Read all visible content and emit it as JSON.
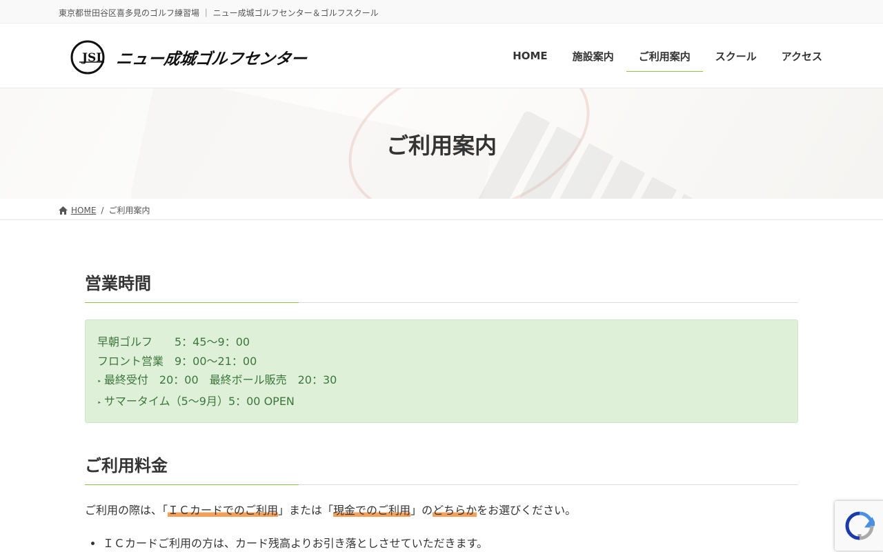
{
  "topbar": {
    "text": "東京都世田谷区喜多見のゴルフ練習場 ｜ ニュー成城ゴルフセンター＆ゴルフスクール"
  },
  "header": {
    "logo_text": "ニュー成城ゴルフセンター",
    "nav": [
      {
        "label": "HOME"
      },
      {
        "label": "施設案内"
      },
      {
        "label": "ご利用案内"
      },
      {
        "label": "スクール"
      },
      {
        "label": "アクセス"
      }
    ],
    "active_nav": "ご利用案内"
  },
  "hero": {
    "title": "ご利用案内"
  },
  "breadcrumb": {
    "home": "HOME",
    "separator": "/",
    "current": "ご利用案内"
  },
  "sections": {
    "hours": {
      "heading": "営業時間",
      "lines": [
        "早朝ゴルフ　　5：45〜9：00",
        "フロント営業　9：00〜21：00",
        "最終受付　20：00　最終ボール販売　20：30",
        "サマータイム（5〜9月）5：00 OPEN"
      ]
    },
    "fees": {
      "heading": "ご利用料金",
      "intro_1": "ご利用の際は、「",
      "intro_hl_1": "ＩＣカードでのご利用",
      "intro_2": "」または「",
      "intro_hl_2": "現金でのご利用",
      "intro_3": "」の",
      "intro_hl_3": "どちらか",
      "intro_4": "をお選びください。",
      "list": [
        "ＩＣカードご利用の方は、カード残高よりお引き落としさせていただきます。"
      ]
    }
  },
  "colors": {
    "accent_green": "#8cc63f",
    "highlight_orange": "#f5a05a",
    "box_bg": "#dff0d8",
    "box_text": "#3c763d"
  }
}
